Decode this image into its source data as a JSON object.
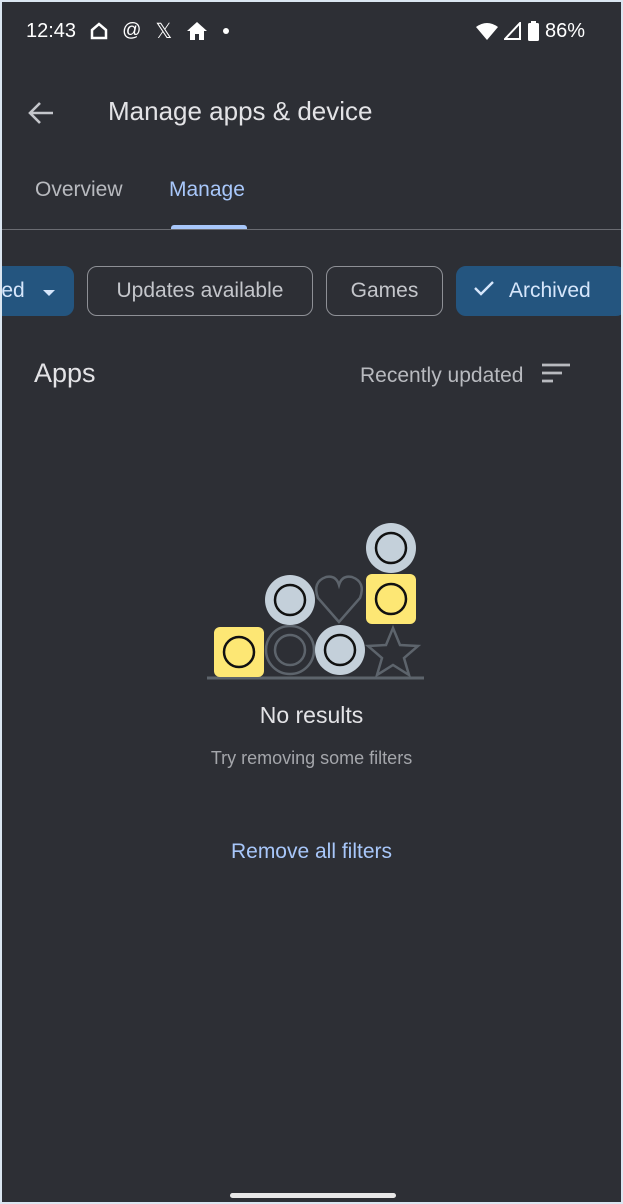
{
  "status_bar": {
    "time": "12:43",
    "battery": "86%",
    "icons": [
      "home-outline-icon",
      "threads-icon",
      "x-icon",
      "home-filled-icon",
      "dot-icon",
      "wifi-icon",
      "signal-icon",
      "battery-icon"
    ]
  },
  "app_bar": {
    "title": "Manage apps & device"
  },
  "tabs": [
    {
      "label": "Overview",
      "active": false
    },
    {
      "label": "Manage",
      "active": true
    }
  ],
  "filters": [
    {
      "label": "ed",
      "selected": true,
      "dropdown": true
    },
    {
      "label": "Updates available",
      "selected": false
    },
    {
      "label": "Games",
      "selected": false
    },
    {
      "label": "Archived",
      "selected": true
    }
  ],
  "section": {
    "title": "Apps",
    "sort_label": "Recently updated"
  },
  "empty": {
    "title": "No results",
    "subtitle": "Try removing some filters",
    "action": "Remove all filters"
  },
  "colors": {
    "background": "#2d2f35",
    "accent": "#a8c7fa",
    "chip_selected": "#24557f",
    "yellow": "#fde774",
    "grey_tile": "#c4d0da"
  }
}
